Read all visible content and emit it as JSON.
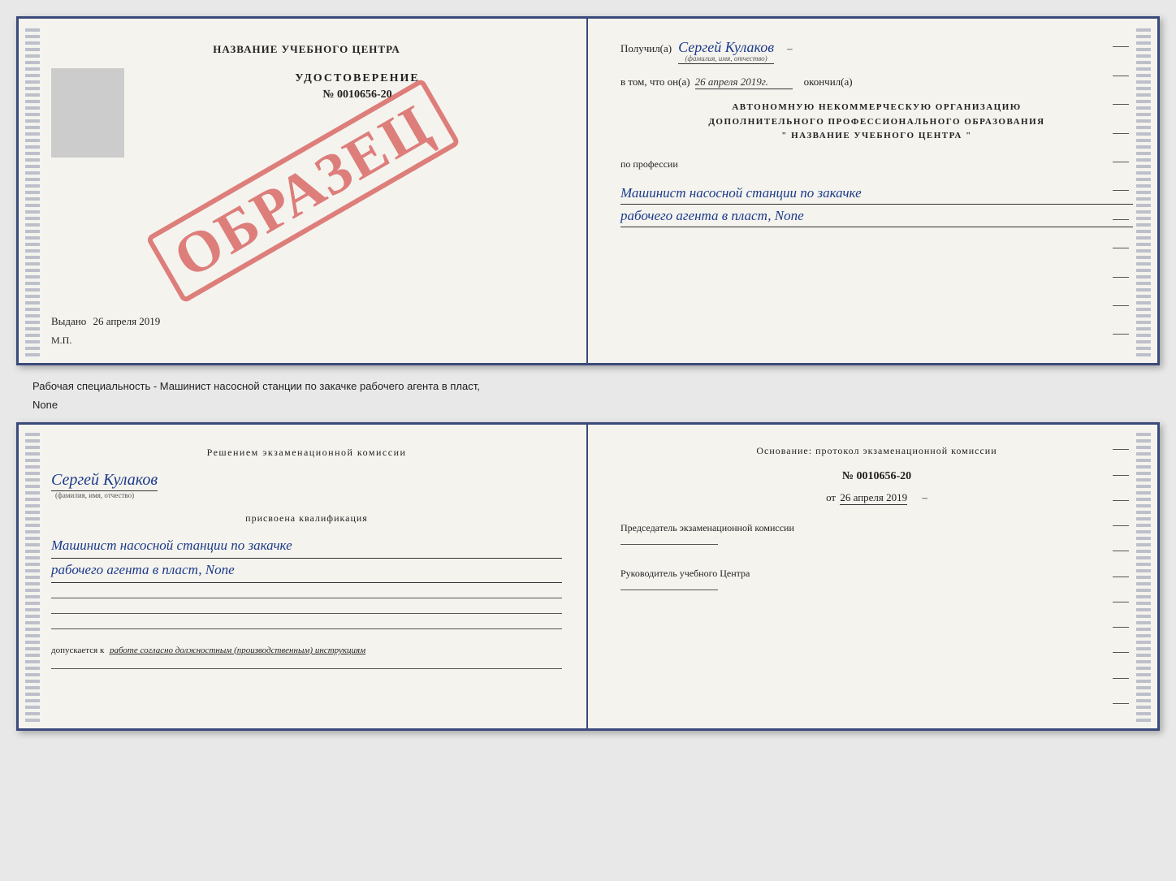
{
  "cert_top": {
    "left": {
      "title": "НАЗВАНИЕ УЧЕБНОГО ЦЕНТРА",
      "udostoverenie_label": "УДОСТОВЕРЕНИЕ",
      "number": "№ 0010656-20",
      "date_label": "Выдано",
      "date_value": "26 апреля 2019",
      "mp_label": "М.П.",
      "obrazec": "ОБРАЗЕЦ"
    },
    "right": {
      "poluchil_label": "Получил(а)",
      "poluchil_name": "Сергей Кулаков",
      "poluchil_sub": "(фамилия, имя, отчество)",
      "dash": "–",
      "vtom_label": "в том, что он(а)",
      "date_value": "26 апреля 2019г.",
      "okonchil_label": "окончил(а)",
      "org_line1": "АВТОНОМНУЮ НЕКОММЕРЧЕСКУЮ ОРГАНИЗАЦИЮ",
      "org_line2": "ДОПОЛНИТЕЛЬНОГО ПРОФЕССИОНАЛЬНОГО ОБРАЗОВАНИЯ",
      "org_line3": "\"  НАЗВАНИЕ УЧЕБНОГО ЦЕНТРА  \"",
      "po_professii": "по профессии",
      "profession_line1": "Машинист насосной станции по закачке",
      "profession_line2": "рабочего агента в пласт, None"
    }
  },
  "specialty_subtitle": "Рабочая специальность - Машинист насосной станции по закачке рабочего агента в пласт,",
  "specialty_subtitle2": "None",
  "cert_bottom": {
    "left": {
      "resheniem_text": "Решением  экзаменационной  комиссии",
      "fio_name": "Сергей Кулаков",
      "fio_sub": "(фамилия, имя, отчество)",
      "prisvoena": "присвоена квалификация",
      "qual_line1": "Машинист насосной станции по закачке",
      "qual_line2": "рабочего агента в пласт, None",
      "dopusk_prefix": "допускается к",
      "dopusk_text": "работе согласно должностным (производственным) инструкциям"
    },
    "right": {
      "osnovaniye_text": "Основание:  протокол  экзаменационной  комиссии",
      "number": "№  0010656-20",
      "date_prefix": "от",
      "date_value": "26 апреля 2019",
      "predsedatel_label": "Председатель экзаменационной комиссии",
      "rukovoditel_label": "Руководитель учебного Центра"
    }
  }
}
